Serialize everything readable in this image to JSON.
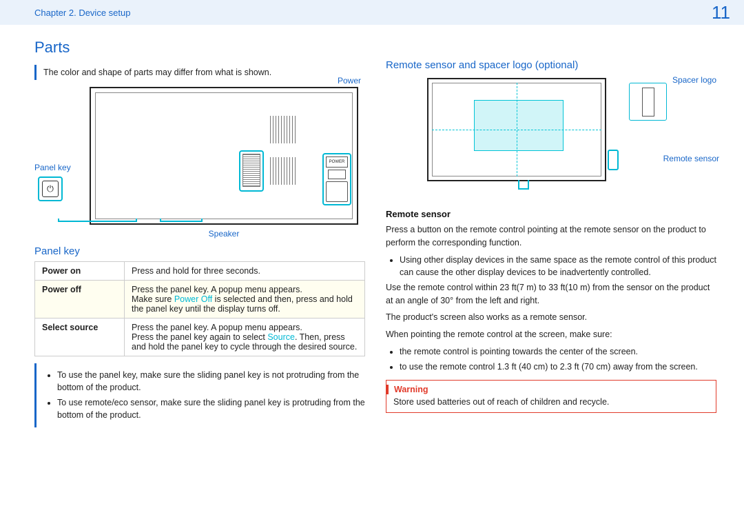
{
  "header": {
    "chapter": "Chapter 2. Device setup",
    "page": "11"
  },
  "left": {
    "title": "Parts",
    "note": "The color and shape of parts may differ from what is shown.",
    "labels": {
      "power": "Power",
      "panel_key": "Panel key",
      "speaker": "Speaker"
    },
    "panel_key_heading": "Panel key",
    "table": {
      "power_on": {
        "label": "Power on",
        "text": "Press and hold for three seconds."
      },
      "power_off": {
        "label": "Power off",
        "line1": "Press the panel key. A popup menu appears.",
        "line2a": "Make sure ",
        "line2b": "Power Off",
        "line2c": " is selected and then, press and hold the panel key until the display turns off."
      },
      "select_source": {
        "label": "Select source",
        "line1": "Press the panel key. A popup menu appears.",
        "line2a": "Press the panel key again to select ",
        "line2b": "Source",
        "line2c": ". Then, press and hold the panel key to cycle through the desired source."
      }
    },
    "bottom_notes": {
      "n1": "To use the panel key, make sure the sliding panel key is not protruding from the bottom of the product.",
      "n2": "To use remote/eco sensor, make sure the sliding panel key is protruding from the bottom of the product."
    }
  },
  "right": {
    "heading": "Remote sensor and spacer logo (optional)",
    "labels": {
      "spacer": "Spacer logo",
      "remote_sensor": "Remote sensor"
    },
    "remote_sensor_heading": "Remote sensor",
    "p1": "Press a button on the remote control pointing at the remote sensor on the product to perform the corresponding function.",
    "bullet1": "Using other display devices in the same space as the remote control of this product can cause the other display devices to be inadvertently controlled.",
    "p2": "Use the remote control within 23 ft(7 m) to 33 ft(10 m) from the sensor on the product at an angle of 30° from the left and right.",
    "p3": "The product's screen also works as a remote sensor.",
    "p4": "When pointing the remote control at the screen, make sure:",
    "b2": "the remote control is pointing towards the center of the screen.",
    "b3": "to use the remote control 1.3 ft (40 cm) to 2.3 ft (70 cm) away from the screen.",
    "warning_label": "Warning",
    "warning_text": "Store used batteries out of reach of children and recycle."
  }
}
